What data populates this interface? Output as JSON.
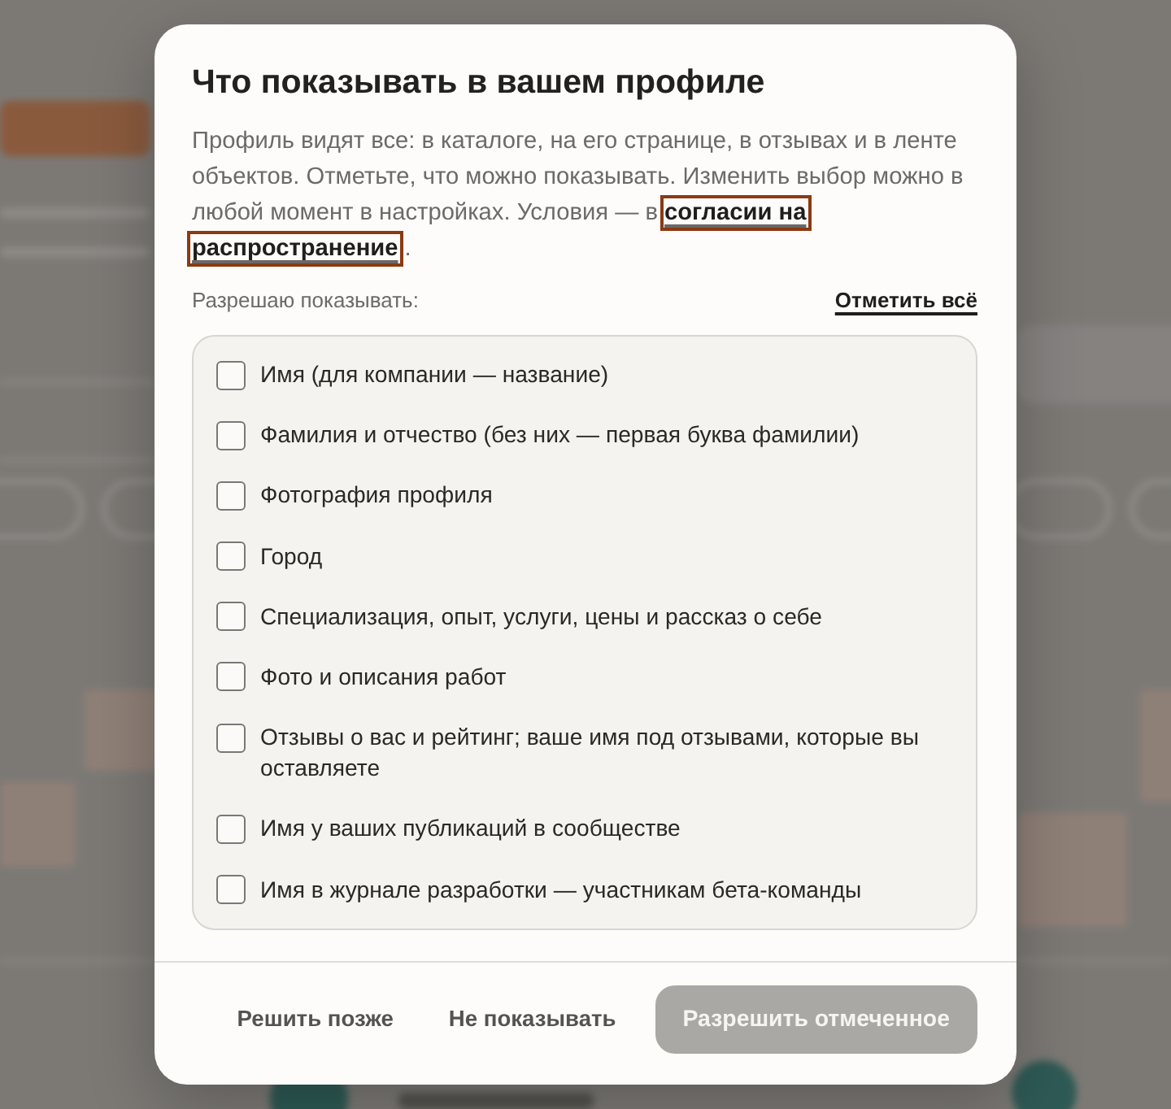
{
  "dialog": {
    "title": "Что показывать в вашем профиле",
    "description": {
      "text": "Профиль видят все: в каталоге, на его странице, в отзывах и в ленте объектов. Отметьте, что можно показывать. Изменить выбор можно в любой момент в настройках. Условия — в",
      "link_parts": [
        "согласии на",
        "распространение"
      ],
      "link_focused": true,
      "after": "."
    },
    "list_label": "Разрешаю показывать:",
    "select_all": "Отметить всё",
    "options": [
      {
        "label": "Имя (для компании — название)",
        "checked": false
      },
      {
        "label": "Фамилия и отчество (без них — первая буква фамилии)",
        "checked": false
      },
      {
        "label": "Фотография профиля",
        "checked": false
      },
      {
        "label": "Город",
        "checked": false
      },
      {
        "label": "Специализация, опыт, услуги, цены и рассказ о себе",
        "checked": false
      },
      {
        "label": "Фото и описания работ",
        "checked": false
      },
      {
        "label": "Отзывы о вас и рейтинг; ваше имя под отзывами, которые вы оставляете",
        "checked": false
      },
      {
        "label": "Имя у ваших публикаций в сообществе",
        "checked": false
      },
      {
        "label": "Имя в журнале разработки — участникам бета-команды",
        "checked": false
      }
    ],
    "buttons": [
      {
        "label": "Решить позже",
        "kind": "text"
      },
      {
        "label": "Не показывать",
        "kind": "text"
      },
      {
        "label": "Разрешить отмеченное",
        "kind": "primary",
        "disabled": true
      }
    ]
  }
}
